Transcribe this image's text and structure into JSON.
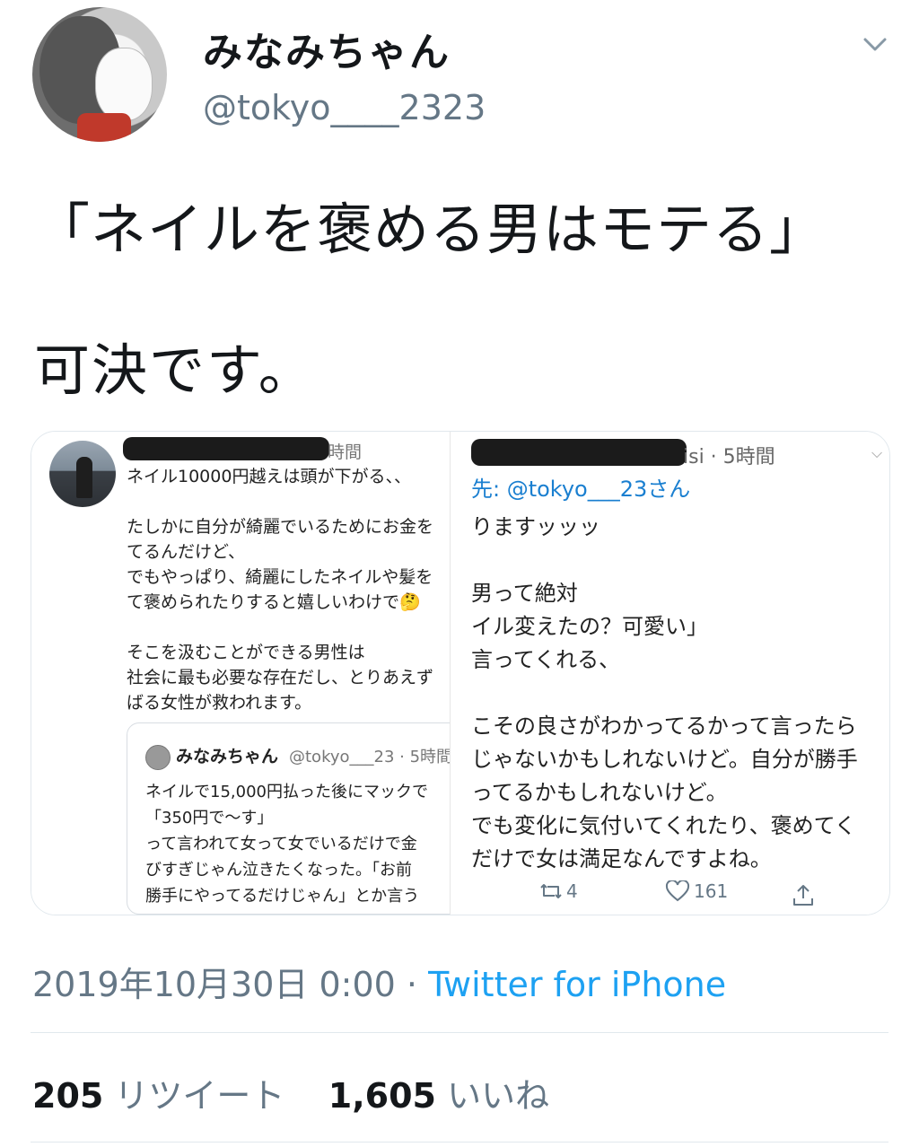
{
  "tweet": {
    "display_name": "みなみちゃん",
    "handle": "@tokyo____2323",
    "text_line1": "「ネイルを褒める男はモテる」",
    "text_line2": "可決です。",
    "timestamp": "2019年10月30日 0:00",
    "separator": "·",
    "source": "Twitter for iPhone",
    "retweets_count": "205",
    "retweets_label": "リツイート",
    "likes_count": "1,605",
    "likes_label": "いいね"
  },
  "media_left": {
    "time": "時間",
    "body": "ネイル10000円越えは頭が下がる、、\n\nたしかに自分が綺麗でいるためにお金を\nてるんだけど、\nでもやっぱり、綺麗にしたネイルや髪を\nて褒められたりすると嬉しいわけで🤔\n\nそこを汲むことができる男性は\n社会に最も必要な存在だし、とりあえず\nばる女性が救われます。",
    "quote": {
      "name": "みなみちゃん",
      "meta": "@tokyo___23 · 5時間",
      "body": "ネイルで15,000円払った後にマックで\n「350円で〜す」\nって言われて女って女でいるだけで金\nびすぎじゃん泣きたくなった。「お前\n勝手にやってるだけじゃん」とか言う"
    }
  },
  "media_right": {
    "time": "isi · 5時間",
    "reply_to": "先: @tokyo___23さん",
    "body": "りますッッッ\n\n男って絶対\nイル変えたの？可愛い」\n言ってくれる、\n\nこその良さがわかってるかって言ったら\nじゃないかもしれないけど。自分が勝手\nってるかもしれないけど。\nでも変化に気付いてくれたり、褒めてく\nだけで女は満足なんですよね。",
    "retweets": "4",
    "likes": "161"
  },
  "icons": [
    "caret-down-icon",
    "retweet-icon",
    "heart-icon",
    "share-icon"
  ]
}
